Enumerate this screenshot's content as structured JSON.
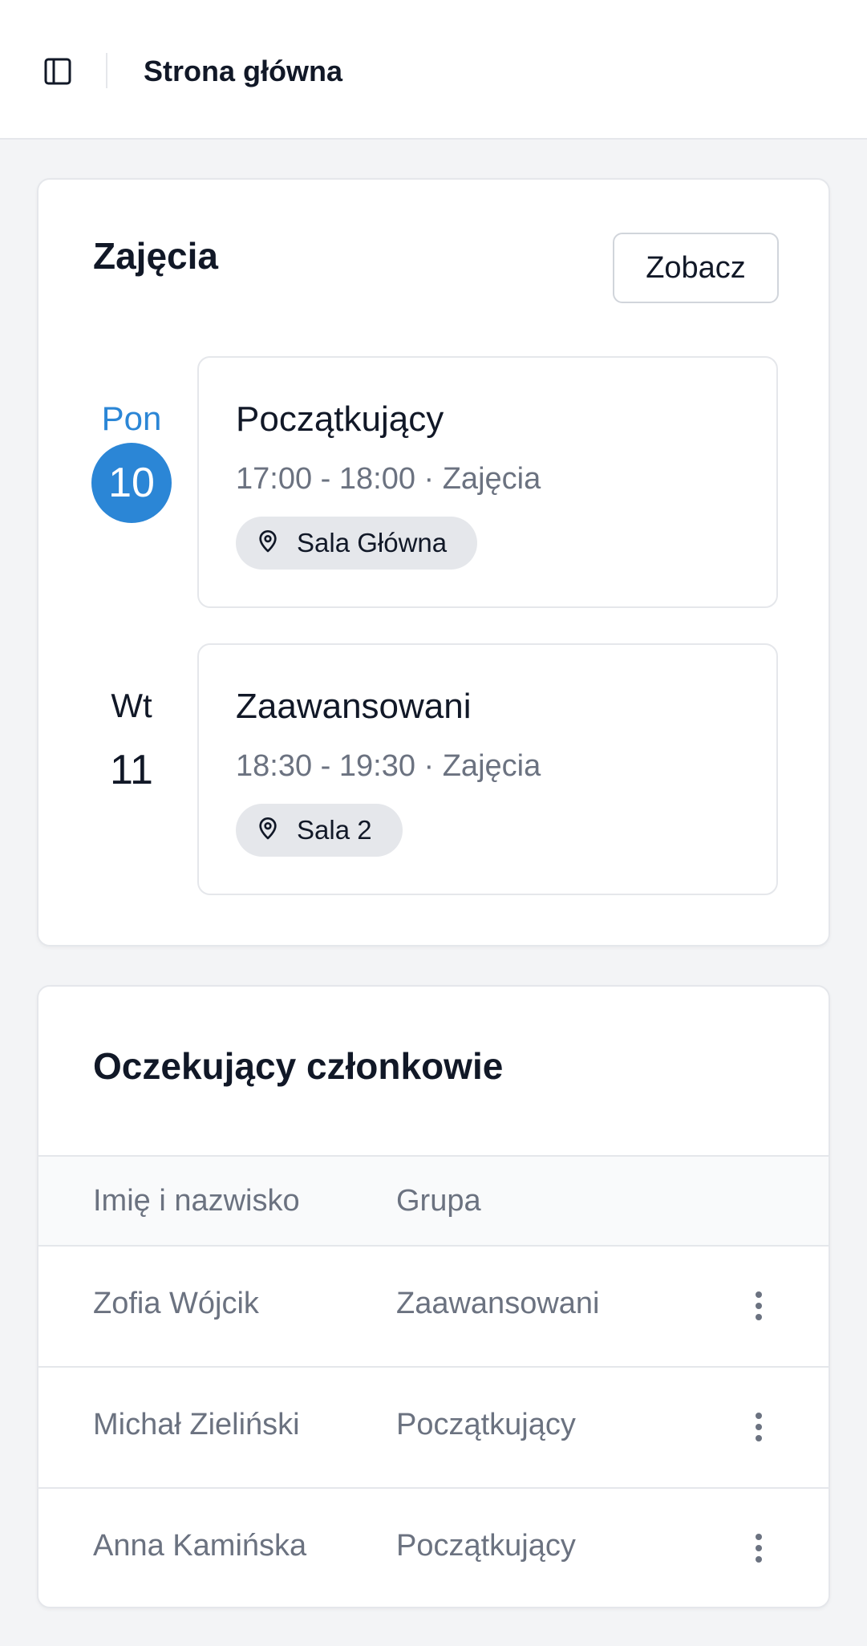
{
  "header": {
    "title": "Strona główna",
    "sidebar_toggle_icon": "sidebar-panel-icon"
  },
  "classes": {
    "title": "Zajęcia",
    "view_label": "Zobacz",
    "days": [
      {
        "day_name": "Pon",
        "day_number": "10",
        "active": true,
        "event": {
          "name": "Początkujący",
          "time": "17:00 - 18:00 · Zajęcia",
          "room": "Sala Główna",
          "room_icon": "map-pin-icon"
        }
      },
      {
        "day_name": "Wt",
        "day_number": "11",
        "active": false,
        "event": {
          "name": "Zaawansowani",
          "time": "18:30 - 19:30 · Zajęcia",
          "room": "Sala 2",
          "room_icon": "map-pin-icon"
        }
      }
    ]
  },
  "pending_members": {
    "title": "Oczekujący członkowie",
    "columns": [
      "Imię i nazwisko",
      "Grupa"
    ],
    "rows": [
      {
        "name": "Zofia Wójcik",
        "group": "Zaawansowani",
        "action_icon": "more-vertical-icon"
      },
      {
        "name": "Michał Zieliński",
        "group": "Początkujący",
        "action_icon": "more-vertical-icon"
      },
      {
        "name": "Anna Kamińska",
        "group": "Początkujący",
        "action_icon": "more-vertical-icon"
      }
    ]
  },
  "colors": {
    "accent": "#2b86d6",
    "background": "#f3f4f6",
    "border": "#e5e7eb",
    "muted_text": "#6b7280"
  }
}
